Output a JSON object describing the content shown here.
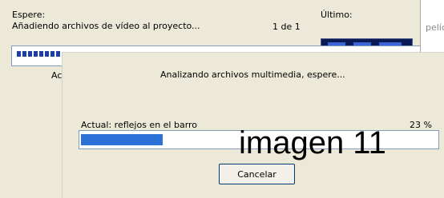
{
  "background": {
    "wait_label": "Espere:",
    "adding_text": "Añadiendo archivos de vídeo al proyecto...",
    "counter": "1 de 1",
    "last_label": "Último:",
    "partial_label": "Ac",
    "right_partial": "pelíc"
  },
  "dialog": {
    "message": "Analizando archivos multimedia, espere...",
    "current_label": "Actual: reflejos en el barro",
    "percent_text": "23 %",
    "progress": 0.23,
    "cancel_label": "Cancelar"
  },
  "watermark": "imagen 11",
  "colors": {
    "dialog_bg": "#ece9d8",
    "progress_fill": "#2b71d8",
    "progress_border": "#7f9db9"
  }
}
